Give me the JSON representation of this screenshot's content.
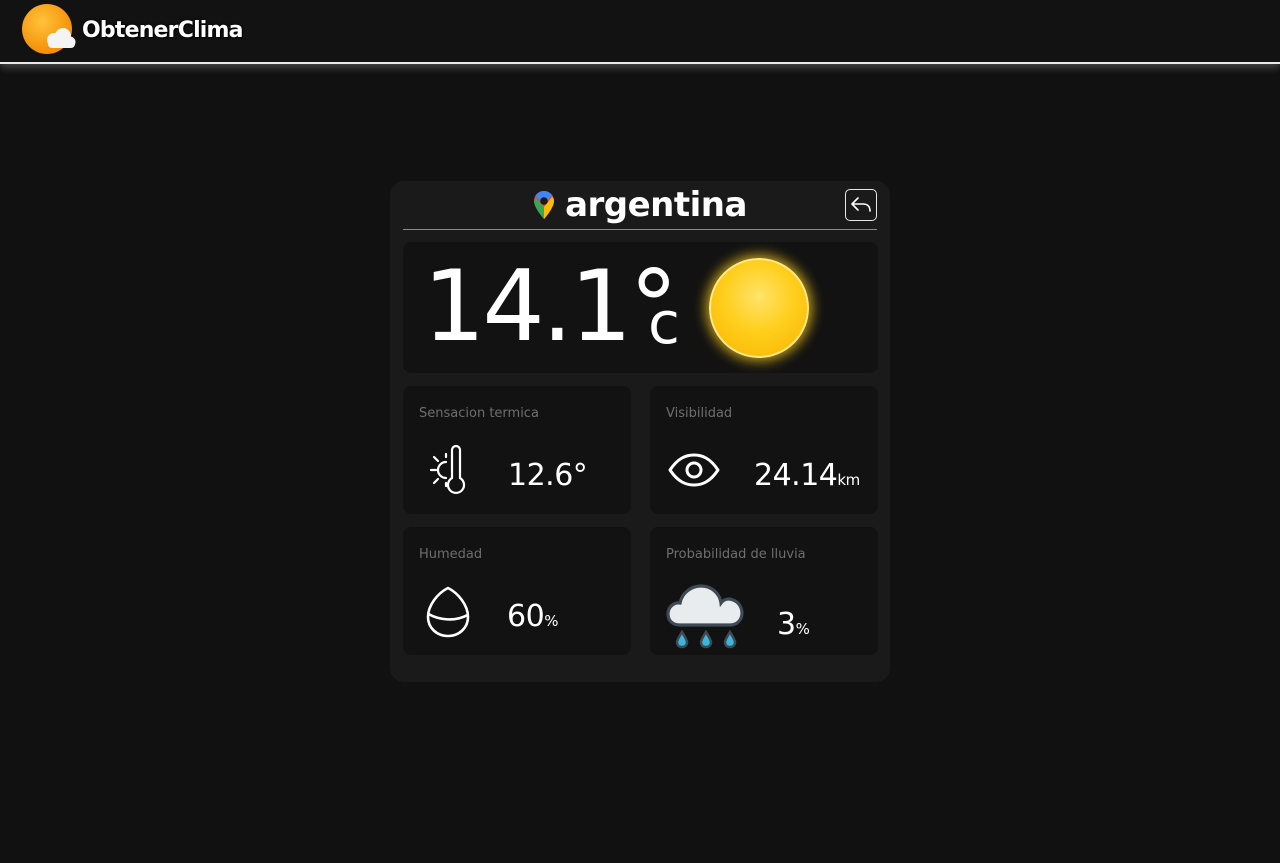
{
  "header": {
    "brand_name": "ObtenerClima",
    "logo_icon": "sun-cloud-logo-icon"
  },
  "location": {
    "icon": "map-pin-icon",
    "name": "argentina",
    "back_icon": "return-arrow-icon"
  },
  "current": {
    "temperature": "14.1°",
    "unit": "c",
    "condition_icon": "sun-icon"
  },
  "stats": {
    "feels_like": {
      "title": "Sensacion termica",
      "value": "12.6°",
      "unit": "",
      "icon": "thermometer-sun-icon"
    },
    "visibility": {
      "title": "Visibilidad",
      "value": "24.14",
      "unit": "km",
      "icon": "eye-icon"
    },
    "humidity": {
      "title": "Humedad",
      "value": "60",
      "unit": "%",
      "icon": "humidity-drop-icon"
    },
    "rain": {
      "title": "Probabilidad de lluvia",
      "value": "3",
      "unit": "%",
      "icon": "rain-cloud-icon"
    }
  },
  "colors": {
    "background": "#111111",
    "card": "#1a1a1a",
    "panel": "#121212",
    "sun": "#ffcf1d",
    "logo_orange": "#f59a00",
    "rain_drop": "#3ab7dd"
  }
}
